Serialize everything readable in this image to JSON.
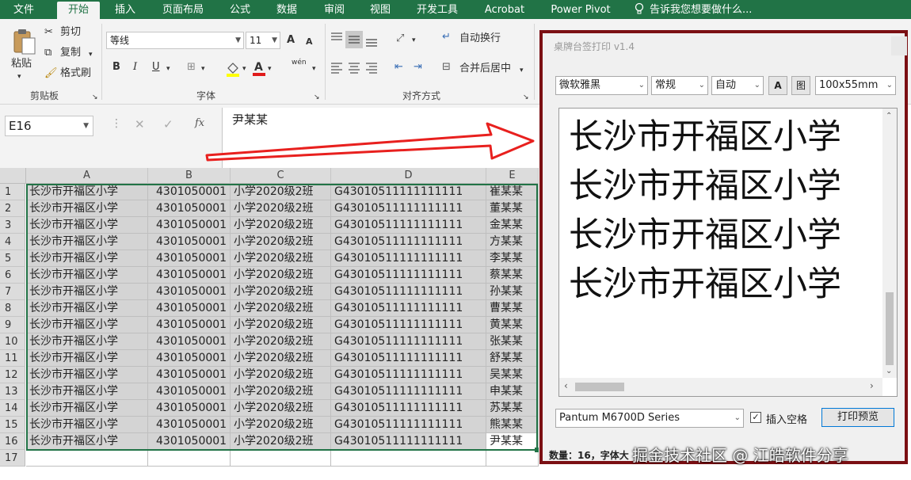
{
  "ribbon_tabs": [
    "文件",
    "开始",
    "插入",
    "页面布局",
    "公式",
    "数据",
    "审阅",
    "视图",
    "开发工具",
    "Acrobat",
    "Power Pivot"
  ],
  "tell_me": "告诉我您想要做什么...",
  "clipboard": {
    "paste": "粘贴",
    "cut": "剪切",
    "copy": "复制",
    "format_painter": "格式刷",
    "group_label": "剪贴板"
  },
  "font": {
    "name": "等线",
    "size": "11",
    "group_label": "字体",
    "bold": "B",
    "italic": "I",
    "underline": "U",
    "grow": "A",
    "shrink": "A",
    "wen": "wén"
  },
  "alignment": {
    "wrap_text": "自动换行",
    "merge_center": "合并后居中",
    "group_label": "对齐方式"
  },
  "name_box": "E16",
  "formula_value": "尹某某",
  "fx": "fx",
  "columns": [
    "A",
    "B",
    "C",
    "D",
    "E"
  ],
  "rows": [
    {
      "n": "1",
      "a": "长沙市开福区小学",
      "b": "4301050001",
      "c": "小学2020级2班",
      "d": "G43010511111111111",
      "e": "崔某某"
    },
    {
      "n": "2",
      "a": "长沙市开福区小学",
      "b": "4301050001",
      "c": "小学2020级2班",
      "d": "G43010511111111111",
      "e": "董某某"
    },
    {
      "n": "3",
      "a": "长沙市开福区小学",
      "b": "4301050001",
      "c": "小学2020级2班",
      "d": "G43010511111111111",
      "e": "金某某"
    },
    {
      "n": "4",
      "a": "长沙市开福区小学",
      "b": "4301050001",
      "c": "小学2020级2班",
      "d": "G43010511111111111",
      "e": "方某某"
    },
    {
      "n": "5",
      "a": "长沙市开福区小学",
      "b": "4301050001",
      "c": "小学2020级2班",
      "d": "G43010511111111111",
      "e": "李某某"
    },
    {
      "n": "6",
      "a": "长沙市开福区小学",
      "b": "4301050001",
      "c": "小学2020级2班",
      "d": "G43010511111111111",
      "e": "蔡某某"
    },
    {
      "n": "7",
      "a": "长沙市开福区小学",
      "b": "4301050001",
      "c": "小学2020级2班",
      "d": "G43010511111111111",
      "e": "孙某某"
    },
    {
      "n": "8",
      "a": "长沙市开福区小学",
      "b": "4301050001",
      "c": "小学2020级2班",
      "d": "G43010511111111111",
      "e": "曹某某"
    },
    {
      "n": "9",
      "a": "长沙市开福区小学",
      "b": "4301050001",
      "c": "小学2020级2班",
      "d": "G43010511111111111",
      "e": "黄某某"
    },
    {
      "n": "10",
      "a": "长沙市开福区小学",
      "b": "4301050001",
      "c": "小学2020级2班",
      "d": "G43010511111111111",
      "e": "张某某"
    },
    {
      "n": "11",
      "a": "长沙市开福区小学",
      "b": "4301050001",
      "c": "小学2020级2班",
      "d": "G43010511111111111",
      "e": "舒某某"
    },
    {
      "n": "12",
      "a": "长沙市开福区小学",
      "b": "4301050001",
      "c": "小学2020级2班",
      "d": "G43010511111111111",
      "e": "吴某某"
    },
    {
      "n": "13",
      "a": "长沙市开福区小学",
      "b": "4301050001",
      "c": "小学2020级2班",
      "d": "G43010511111111111",
      "e": "申某某"
    },
    {
      "n": "14",
      "a": "长沙市开福区小学",
      "b": "4301050001",
      "c": "小学2020级2班",
      "d": "G43010511111111111",
      "e": "苏某某"
    },
    {
      "n": "15",
      "a": "长沙市开福区小学",
      "b": "4301050001",
      "c": "小学2020级2班",
      "d": "G43010511111111111",
      "e": "熊某某"
    },
    {
      "n": "16",
      "a": "长沙市开福区小学",
      "b": "4301050001",
      "c": "小学2020级2班",
      "d": "G43010511111111111",
      "e": "尹某某"
    },
    {
      "n": "17",
      "a": "",
      "b": "",
      "c": "",
      "d": "",
      "e": ""
    }
  ],
  "dialog": {
    "title": "桌牌台签打印 v1.4",
    "font_name": "微软雅黑",
    "font_style": "常规",
    "size_mode": "自动",
    "btn_a": "A",
    "btn_img": "图",
    "paper_size": "100x55mm",
    "preview_lines": [
      "长沙市开福区小学",
      "长沙市开福区小学",
      "长沙市开福区小学",
      "长沙市开福区小学"
    ],
    "printer": "Pantum M6700D Series",
    "insert_space_label": "插入空格",
    "insert_space_checked": true,
    "print_preview": "打印预览",
    "status": "数量：16，字体大"
  },
  "watermark": "掘金技术社区 @ 江皓软件分享",
  "colors": {
    "excel_green": "#217346",
    "dialog_border": "#7b0f13",
    "arrow_red": "#e8201e"
  }
}
